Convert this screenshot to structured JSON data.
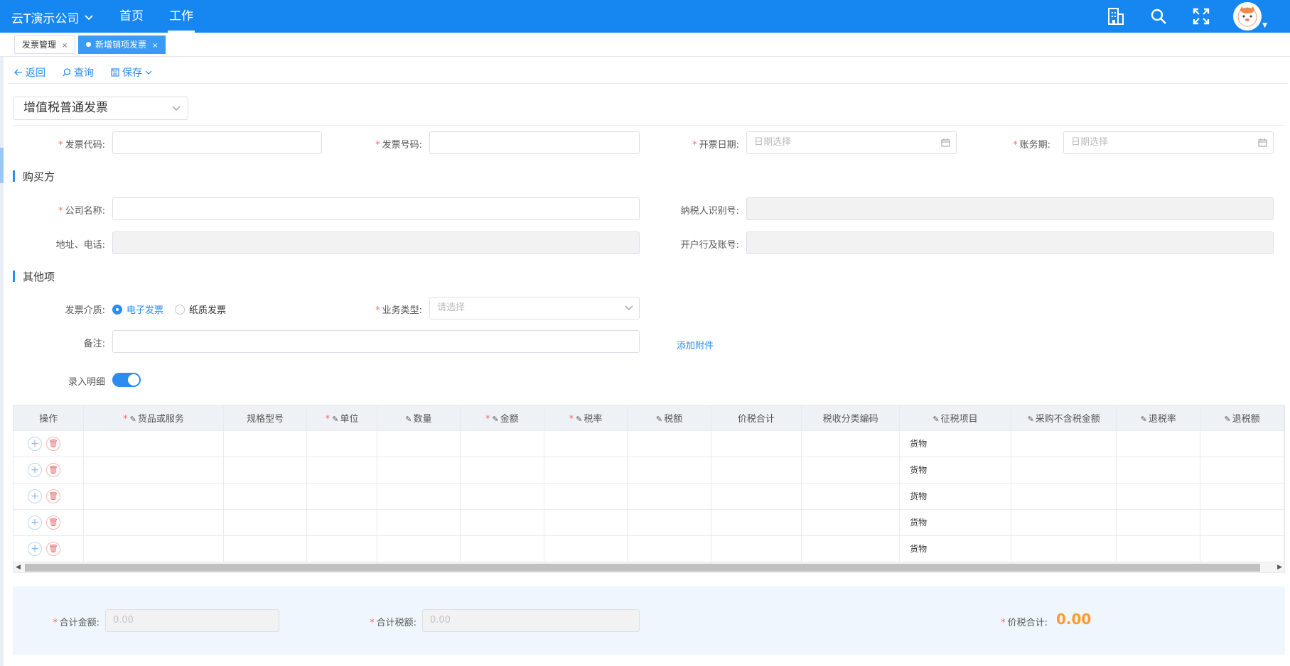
{
  "header": {
    "company": "云T演示公司",
    "nav": [
      "首页",
      "工作"
    ],
    "icons": [
      "building-icon",
      "search-icon",
      "fullscreen-icon"
    ]
  },
  "tabs": [
    {
      "label": "发票管理",
      "active": false
    },
    {
      "label": "新增销项发票",
      "active": true
    }
  ],
  "actions": {
    "back": "返回",
    "query": "查询",
    "save": "保存"
  },
  "invoice_type": "增值税普通发票",
  "fields": {
    "invoice_code": "发票代码:",
    "invoice_no": "发票号码:",
    "issue_date": "开票日期:",
    "issue_date_placeholder": "日期选择",
    "period": "账务期:",
    "period_placeholder": "日期选择"
  },
  "buyer": {
    "title": "购买方",
    "company_name": "公司名称:",
    "tax_id": "纳税人识别号:",
    "address_phone": "地址、电话:",
    "bank_account": "开户行及账号:"
  },
  "other": {
    "title": "其他项",
    "medium_label": "发票介质:",
    "medium_options": [
      "电子发票",
      "纸质发票"
    ],
    "business_type_label": "业务类型:",
    "business_type_placeholder": "请选择",
    "remark_label": "备注:",
    "attach_link": "添加附件",
    "detail_label": "录入明细"
  },
  "table": {
    "columns": [
      "操作",
      "货品或服务",
      "规格型号",
      "单位",
      "数量",
      "金额",
      "税率",
      "税额",
      "价税合计",
      "税收分类编码",
      "征税项目",
      "采购不含税金额",
      "退税率",
      "退税额"
    ],
    "rows": [
      {
        "tax_item": "货物"
      },
      {
        "tax_item": "货物"
      },
      {
        "tax_item": "货物"
      },
      {
        "tax_item": "货物"
      },
      {
        "tax_item": "货物"
      }
    ]
  },
  "totals": {
    "amount_label": "合计金额:",
    "amount_value": "0.00",
    "tax_label": "合计税额:",
    "tax_value": "0.00",
    "grand_label": "价税合计:",
    "grand_value": "0.00"
  },
  "colors": {
    "primary": "#1687f0",
    "accent": "#2d8cf0",
    "orange": "#ff9a2e",
    "required": "#f56c6c"
  }
}
